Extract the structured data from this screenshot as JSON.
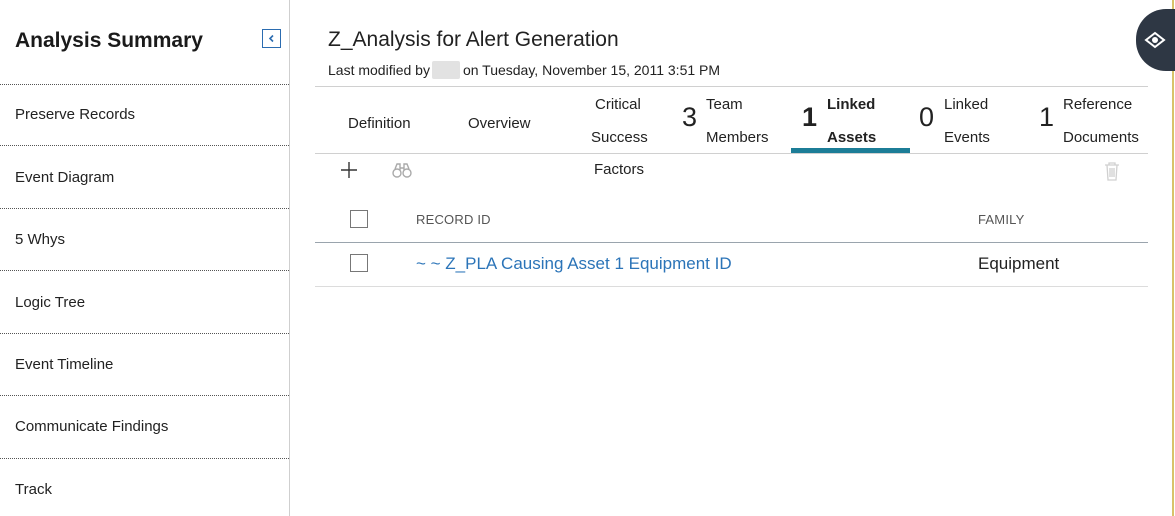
{
  "sidebar": {
    "title": "Analysis Summary",
    "items": [
      {
        "label": "Preserve Records"
      },
      {
        "label": "Event Diagram"
      },
      {
        "label": "5 Whys"
      },
      {
        "label": "Logic Tree"
      },
      {
        "label": "Event Timeline"
      },
      {
        "label": "Communicate Findings"
      },
      {
        "label": "Track"
      }
    ]
  },
  "header": {
    "title": "Z_Analysis for Alert Generation",
    "modified_prefix": "Last modified by",
    "modified_suffix": "on Tuesday, November 15, 2011 3:51 PM"
  },
  "tabs": [
    {
      "label_1": "Definition",
      "label_2": ""
    },
    {
      "label_1": "Overview",
      "label_2": ""
    },
    {
      "label_1": "Critical",
      "label_2": "Success"
    },
    {
      "count": "3",
      "label_1": "Team",
      "label_2": "Members"
    },
    {
      "count": "1",
      "label_1": "Linked",
      "label_2": "Assets"
    },
    {
      "count": "0",
      "label_1": "Linked",
      "label_2": "Events"
    },
    {
      "count": "1",
      "label_1": "Reference",
      "label_2": "Documents"
    }
  ],
  "tab_overflow_label": "Factors",
  "active_tab": "Linked Assets",
  "table": {
    "columns": [
      "RECORD ID",
      "FAMILY"
    ],
    "rows": [
      {
        "record_id": "~ ~ Z_PLA Causing Asset 1 Equipment ID",
        "family": "Equipment"
      }
    ]
  },
  "icons": {
    "collapse": "chevron-left-icon",
    "add": "plus-icon",
    "search": "binoculars-icon",
    "delete": "trash-icon",
    "corner": "eye-icon"
  },
  "colors": {
    "accent": "#1c7d97",
    "link": "#2b74b8",
    "corner_button": "#2e3744"
  }
}
